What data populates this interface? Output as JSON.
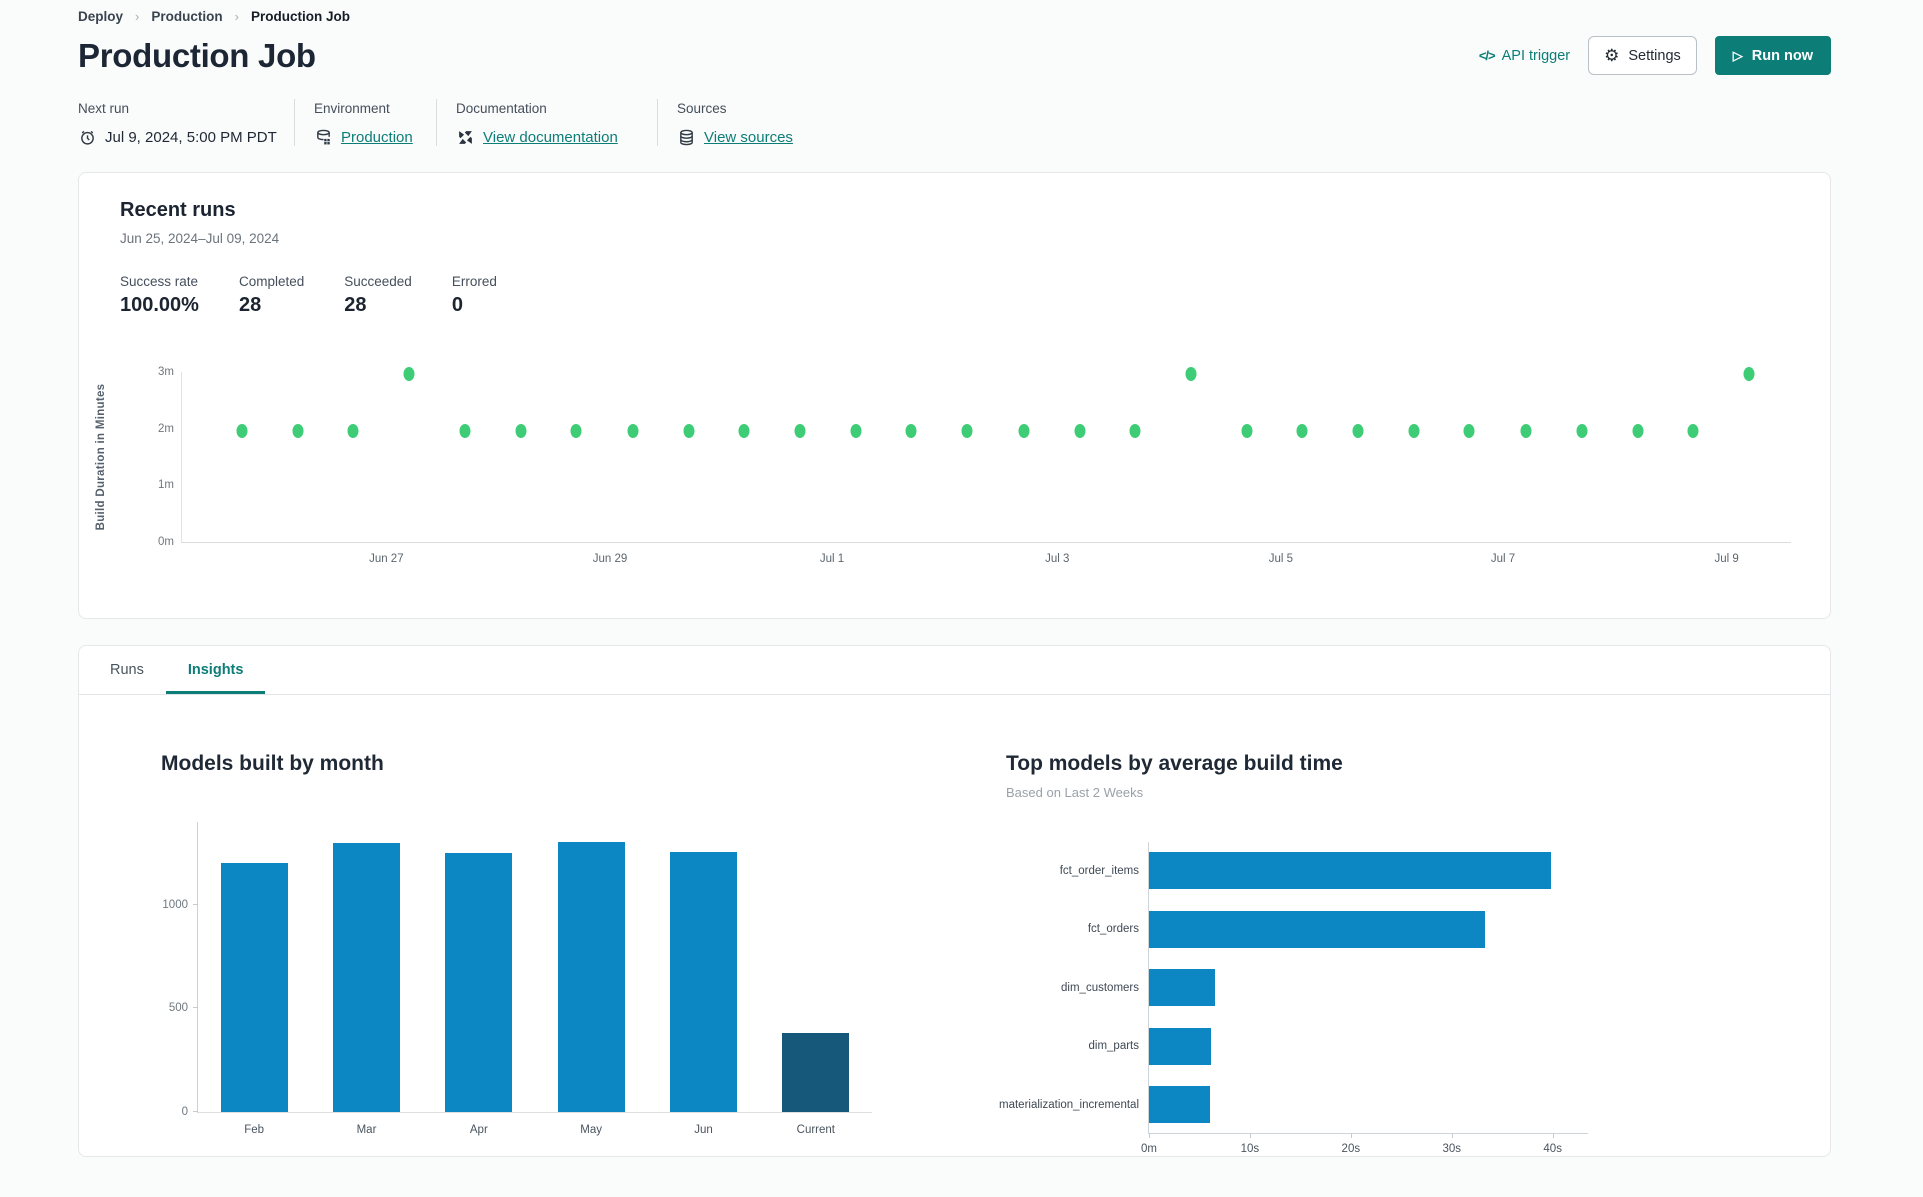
{
  "breadcrumb": {
    "items": [
      "Deploy",
      "Production",
      "Production Job"
    ]
  },
  "header": {
    "title": "Production Job",
    "api_trigger_label": "API trigger",
    "api_trigger_icon": "</>",
    "settings_label": "Settings",
    "run_now_label": "Run now"
  },
  "info": {
    "next_run": {
      "label": "Next run",
      "value": "Jul 9, 2024, 5:00 PM PDT"
    },
    "environment": {
      "label": "Environment",
      "value": "Production"
    },
    "documentation": {
      "label": "Documentation",
      "value": "View documentation"
    },
    "sources": {
      "label": "Sources",
      "value": "View sources"
    }
  },
  "recent_runs": {
    "title": "Recent runs",
    "date_range": "Jun 25, 2024–Jul 09, 2024",
    "stats": [
      {
        "label": "Success rate",
        "value": "100.00%"
      },
      {
        "label": "Completed",
        "value": "28"
      },
      {
        "label": "Succeeded",
        "value": "28"
      },
      {
        "label": "Errored",
        "value": "0"
      }
    ]
  },
  "tabs": [
    {
      "label": "Runs",
      "active": false
    },
    {
      "label": "Insights",
      "active": true
    }
  ],
  "colors": {
    "accent_teal": "#0d7d77",
    "success_green": "#3ecd76",
    "bar_blue": "#0d87c3",
    "bar_dark": "#15587a"
  },
  "chart_data": [
    {
      "id": "build_duration",
      "type": "scatter",
      "ylabel": "Build Duration in Minutes",
      "yticks": [
        "0m",
        "1m",
        "2m",
        "3m"
      ],
      "ytick_values": [
        0,
        1,
        2,
        3
      ],
      "ylim": [
        0,
        3
      ],
      "xticks": [
        "Jun 27",
        "Jun 29",
        "Jul 1",
        "Jul 3",
        "Jul 5",
        "Jul 7",
        "Jul 9"
      ],
      "xtick_pos_pct": [
        12.7,
        26.6,
        40.4,
        54.4,
        68.3,
        82.1,
        96.0
      ],
      "point_color": "#3ecd76",
      "grid": false,
      "points": [
        {
          "x_pct": 3.7,
          "duration_m": 1.96
        },
        {
          "x_pct": 7.2,
          "duration_m": 1.96
        },
        {
          "x_pct": 10.6,
          "duration_m": 1.96
        },
        {
          "x_pct": 14.1,
          "duration_m": 2.97
        },
        {
          "x_pct": 17.6,
          "duration_m": 1.96
        },
        {
          "x_pct": 21.1,
          "duration_m": 1.96
        },
        {
          "x_pct": 24.5,
          "duration_m": 1.96
        },
        {
          "x_pct": 28.0,
          "duration_m": 1.96
        },
        {
          "x_pct": 31.5,
          "duration_m": 1.96
        },
        {
          "x_pct": 34.9,
          "duration_m": 1.96
        },
        {
          "x_pct": 38.4,
          "duration_m": 1.96
        },
        {
          "x_pct": 41.9,
          "duration_m": 1.96
        },
        {
          "x_pct": 45.3,
          "duration_m": 1.96
        },
        {
          "x_pct": 48.8,
          "duration_m": 1.96
        },
        {
          "x_pct": 52.3,
          "duration_m": 1.96
        },
        {
          "x_pct": 55.8,
          "duration_m": 1.96
        },
        {
          "x_pct": 59.2,
          "duration_m": 1.96
        },
        {
          "x_pct": 62.7,
          "duration_m": 2.97
        },
        {
          "x_pct": 66.2,
          "duration_m": 1.96
        },
        {
          "x_pct": 69.6,
          "duration_m": 1.96
        },
        {
          "x_pct": 73.1,
          "duration_m": 1.96
        },
        {
          "x_pct": 76.6,
          "duration_m": 1.96
        },
        {
          "x_pct": 80.0,
          "duration_m": 1.96
        },
        {
          "x_pct": 83.5,
          "duration_m": 1.96
        },
        {
          "x_pct": 87.0,
          "duration_m": 1.96
        },
        {
          "x_pct": 90.5,
          "duration_m": 1.96
        },
        {
          "x_pct": 93.9,
          "duration_m": 1.96
        },
        {
          "x_pct": 97.4,
          "duration_m": 2.97
        }
      ]
    },
    {
      "id": "models_built_by_month",
      "type": "bar",
      "title": "Models built by month",
      "categories": [
        "Feb",
        "Mar",
        "Apr",
        "May",
        "Jun",
        "Current"
      ],
      "values": [
        1200,
        1300,
        1250,
        1305,
        1255,
        380
      ],
      "bar_colors": [
        "#0d87c3",
        "#0d87c3",
        "#0d87c3",
        "#0d87c3",
        "#0d87c3",
        "#15587a"
      ],
      "yticks": [
        0,
        500,
        1000
      ],
      "ylim": [
        0,
        1400
      ],
      "grid": false
    },
    {
      "id": "top_models_by_build_time",
      "type": "horizontal_bar",
      "title": "Top models by average build time",
      "subtitle": "Based on Last 2 Weeks",
      "categories": [
        "fct_order_items",
        "fct_orders",
        "dim_customers",
        "dim_parts",
        "materialization_incremental"
      ],
      "values_seconds": [
        39.8,
        33.3,
        6.5,
        6.1,
        6.0
      ],
      "bar_color": "#0d87c3",
      "xticks": [
        "0m",
        "10s",
        "20s",
        "30s",
        "40s"
      ],
      "xtick_values": [
        0,
        10,
        20,
        30,
        40
      ],
      "xlim": [
        0,
        43.5
      ],
      "grid": false
    }
  ]
}
